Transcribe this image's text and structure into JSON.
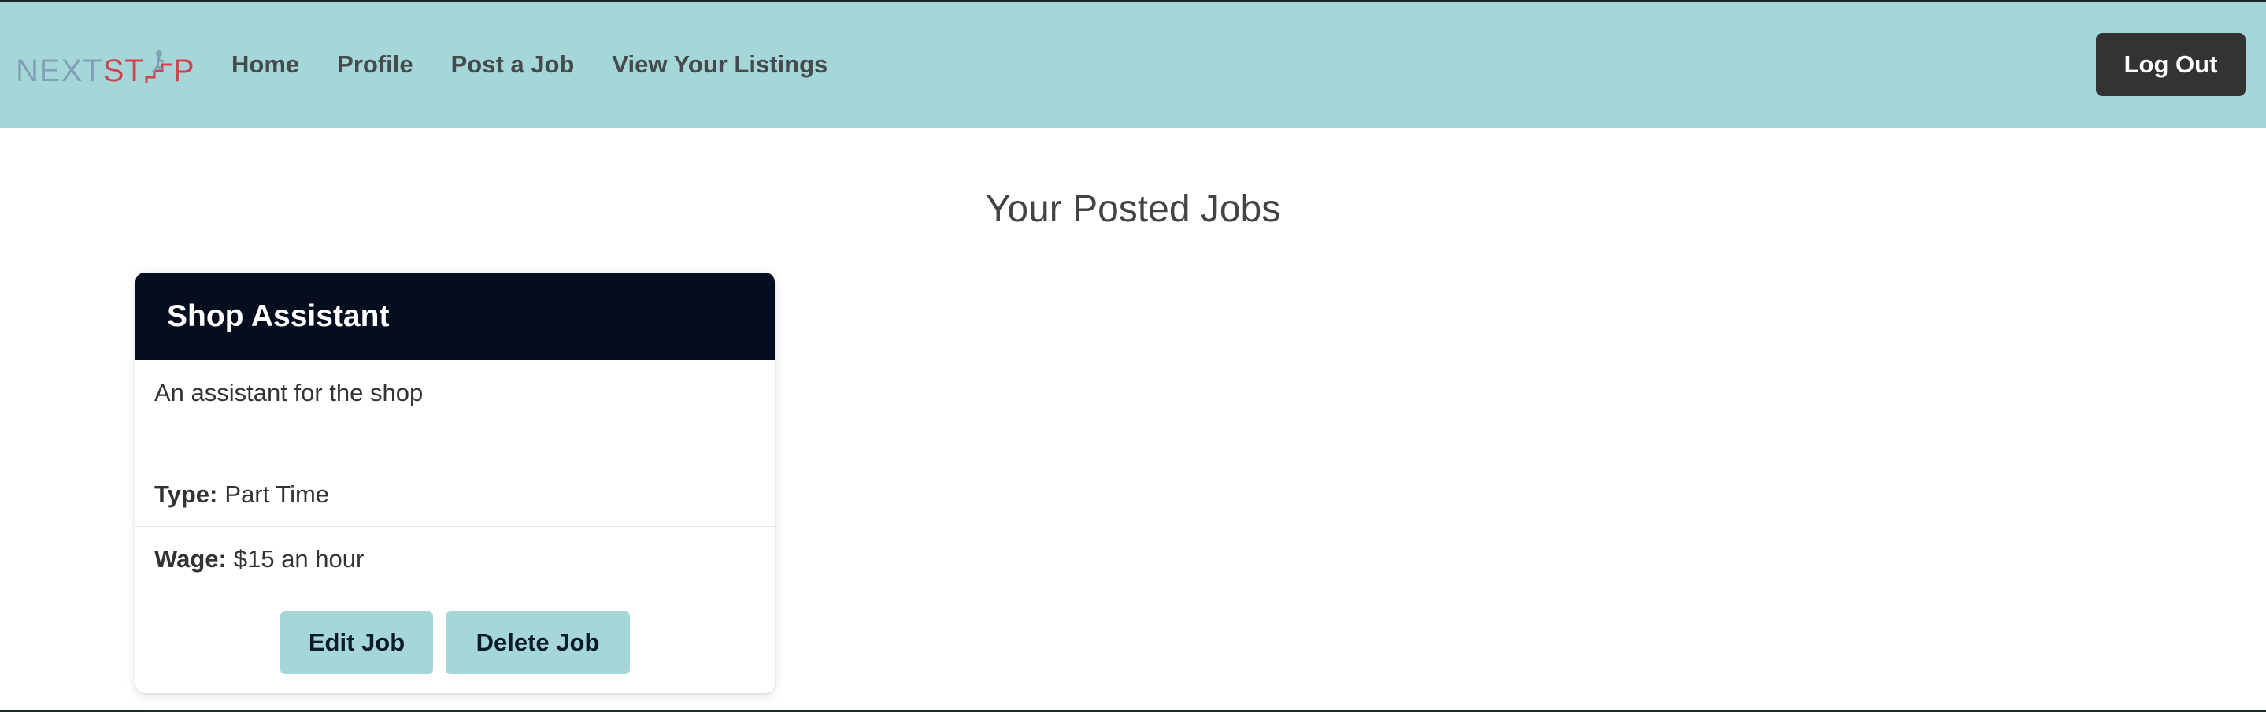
{
  "navbar": {
    "logo": {
      "part1": "NEXT",
      "part2": "ST",
      "part3": "P",
      "icon": "stair-climber-icon"
    },
    "links": [
      {
        "label": "Home"
      },
      {
        "label": "Profile"
      },
      {
        "label": "Post a Job"
      },
      {
        "label": "View Your Listings"
      }
    ],
    "logout_label": "Log Out"
  },
  "main": {
    "heading": "Your Posted Jobs",
    "jobs": [
      {
        "title": "Shop Assistant",
        "description": "An assistant for the shop",
        "type_label": "Type:",
        "type_value": "Part Time",
        "wage_label": "Wage:",
        "wage_value": "$15 an hour",
        "edit_label": "Edit Job",
        "delete_label": "Delete Job"
      }
    ]
  },
  "colors": {
    "navbar_bg": "#a6d7d8",
    "card_header_bg": "#050e1e",
    "logout_bg": "#333333",
    "logo_next": "#7fa1b6",
    "logo_step": "#d1424d"
  }
}
